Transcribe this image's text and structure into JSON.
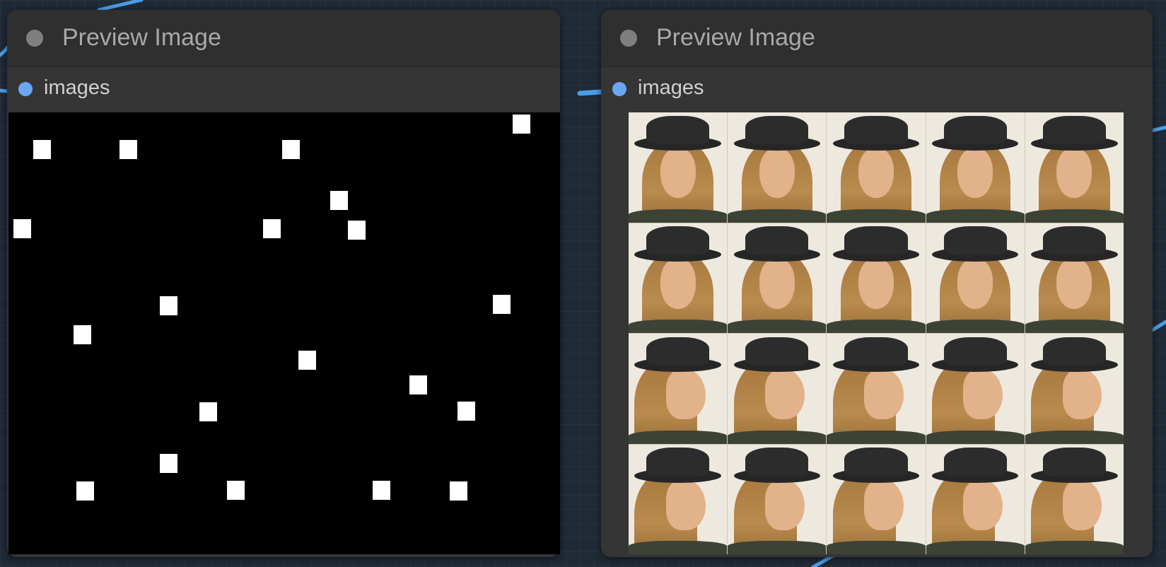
{
  "nodes": [
    {
      "id": "left",
      "title": "Preview Image",
      "input_label": "images",
      "preview_type": "mask"
    },
    {
      "id": "right",
      "title": "Preview Image",
      "input_label": "images",
      "preview_type": "image-grid"
    }
  ],
  "colors": {
    "canvas": "#1f2a36",
    "node_body": "#353535",
    "title_dot": "#7f7f7f",
    "slot_dot": "#6aa7f0",
    "wire": "#4a9ee8",
    "title_text": "#a9a9a9"
  }
}
